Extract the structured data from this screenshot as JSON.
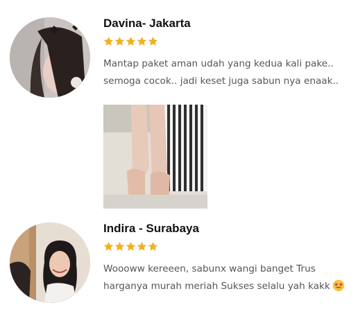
{
  "reviews": [
    {
      "name": "Davina- Jakarta",
      "rating": 5,
      "text": "Mantap paket aman udah yang kedua kali pake.. semoga cocok.. jadi keset juga sabun nya enaak..",
      "has_photo": true
    },
    {
      "name": "Indira - Surabaya",
      "rating": 5,
      "text": "Woooww kereeen, sabunx wangi banget Trus harganya murah meriah Sukses selalu yah kakk",
      "emoji": "star-struck-emoji"
    }
  ],
  "colors": {
    "star": "#f2b01e",
    "name": "#111111",
    "body_text": "#555555"
  },
  "icons": {
    "star": "star-icon",
    "emoji": "star-struck-emoji-icon"
  }
}
